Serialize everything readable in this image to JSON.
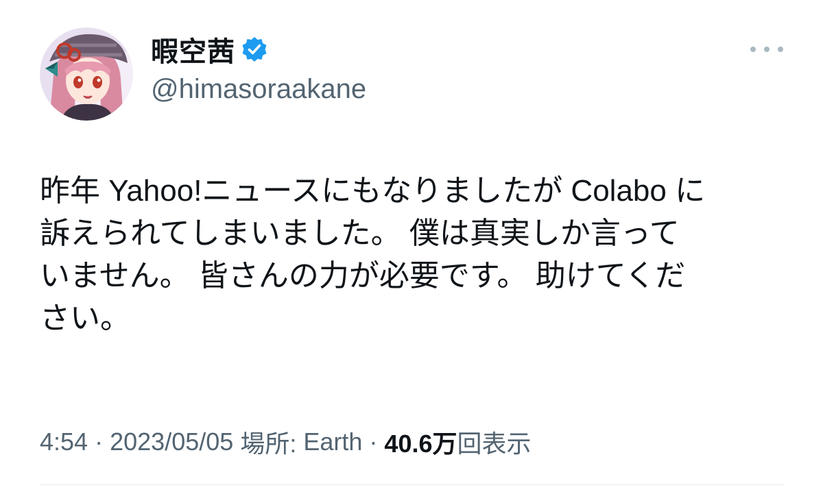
{
  "tweet": {
    "display_name": "暇空茜",
    "handle": "@himasoraakane",
    "verified_icon": "verified-badge-icon",
    "more_icon": "more-options-icon",
    "avatar_icon": "avatar",
    "text": "昨年 Yahoo!ニュースにもなりましたが Colabo に\n訴えられてしまいました。 僕は真実しか言って\nいません。 皆さんの力が必要です。 助けてくだ\nさい。",
    "time": "4:54",
    "separator": "·",
    "date": "2023/05/05",
    "location_label": "場所:",
    "location": "Earth",
    "views_count": "40.6万",
    "views_label": "回表示"
  },
  "colors": {
    "verified_blue": "#1d9bf0",
    "text_primary": "#0f1419",
    "text_secondary": "#536471"
  }
}
